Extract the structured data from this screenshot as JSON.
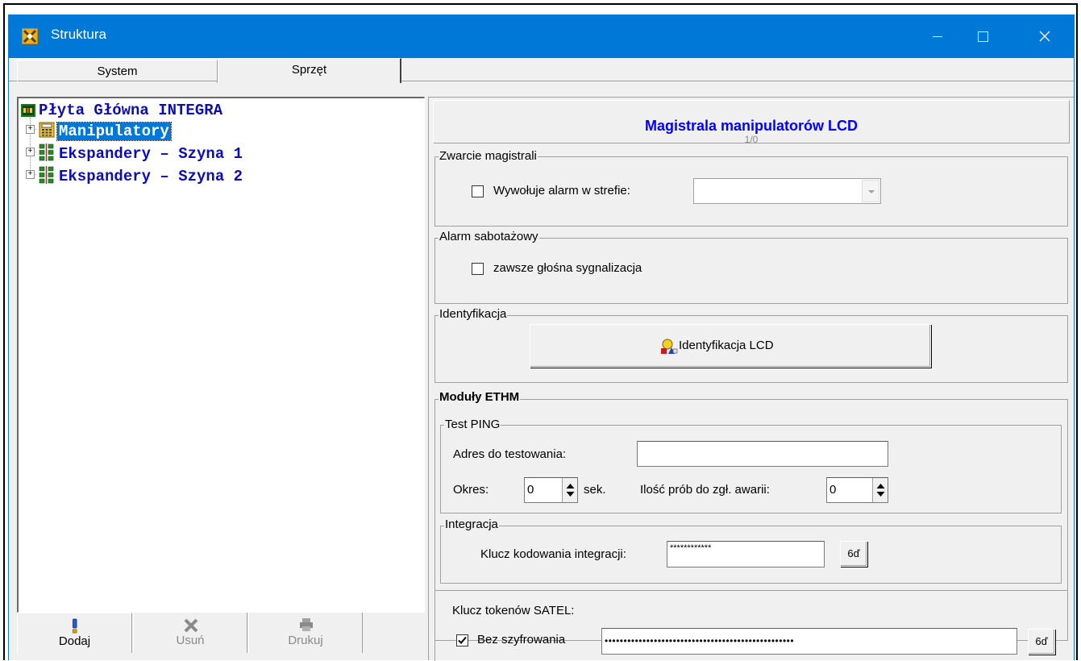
{
  "window": {
    "title": "Struktura",
    "minimize_glyph": "─",
    "maximize_glyph": "☐",
    "close_glyph": "✕"
  },
  "tabs": [
    {
      "label": "System",
      "active": false
    },
    {
      "label": "Sprzęt",
      "active": true
    }
  ],
  "tree": {
    "root": {
      "label": "Płyta Główna INTEGRA",
      "icon": "circuit-board-icon"
    },
    "children": [
      {
        "label": "Manipulatory",
        "icon": "keypad-icon",
        "selected": true,
        "expander": "+"
      },
      {
        "label": "Ekspandery – Szyna 1",
        "icon": "expander-bus-icon",
        "selected": false,
        "expander": "+"
      },
      {
        "label": "Ekspandery – Szyna 2",
        "icon": "expander-bus-icon",
        "selected": false,
        "expander": "+"
      }
    ]
  },
  "bottom_buttons": [
    {
      "label": "Dodaj",
      "icon": "exclamation-icon",
      "enabled": true
    },
    {
      "label": "Usuń",
      "icon": "delete-x-icon",
      "enabled": false
    },
    {
      "label": "Drukuj",
      "icon": "printer-icon",
      "enabled": false
    }
  ],
  "detail": {
    "header": {
      "title": "Magistrala manipulatorów LCD",
      "subtitle": "1/0"
    },
    "bus_short": {
      "legend": "Zwarcie magistrali",
      "checkbox_label": "Wywołuje alarm w strefie:",
      "checked": false,
      "zone_value": ""
    },
    "tamper": {
      "legend": "Alarm sabotażowy",
      "checkbox_label": "zawsze głośna sygnalizacja",
      "checked": false
    },
    "identification": {
      "legend": "Identyfikacja",
      "button_label": "Identyfikacja LCD",
      "button_icon": "identify-shapes-icon"
    },
    "ethm": {
      "legend": "Moduły ETHM",
      "ping": {
        "legend": "Test PING",
        "address_label": "Adres do testowania:",
        "address_value": "",
        "period_label": "Okres:",
        "period_value": "0",
        "period_unit": "sek.",
        "attempts_label": "Ilość prób do zgł. awarii:",
        "attempts_value": "0"
      },
      "integration": {
        "legend": "Integracja",
        "key_label": "Klucz kodowania integracji:",
        "key_value": "************",
        "show_button_icon": "glasses-icon",
        "show_button_label": "6ď"
      }
    },
    "satel": {
      "title": "Klucz tokenów SATEL:",
      "checkbox_label": "Bez szyfrowania",
      "checked": true,
      "key_value": "••••••••••••••••••••••••••••••••••••••••••••••••••",
      "show_button_icon": "glasses-icon",
      "show_button_label": "6ď"
    }
  },
  "colors": {
    "titlebar": "#0078d7",
    "tree_text": "#0d0db5",
    "selection": "#0078d7",
    "header_title": "#0000ff",
    "window_bg": "#f0f0f0"
  }
}
